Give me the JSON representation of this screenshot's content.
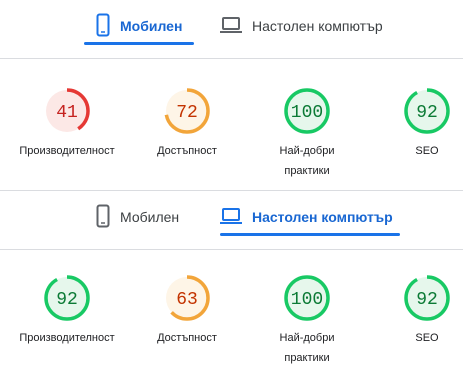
{
  "colors": {
    "accent": "#1a73e8",
    "fail": "#e53935",
    "fail_bg": "#fce8e6",
    "average": "#f2a53a",
    "average_bg": "#fef5e7",
    "average_text": "#c33300",
    "pass": "#18c964",
    "pass_bg": "#e6f7ec",
    "pass_text": "#0b7a35",
    "fail_text": "#c5221f"
  },
  "reports": [
    {
      "tabs": {
        "mobile_label": "Мобилен",
        "desktop_label": "Настолен компютър",
        "active": "mobile"
      },
      "scores": [
        {
          "value": "41",
          "label": "Производителност",
          "level": "fail",
          "score": 0.41
        },
        {
          "value": "72",
          "label": "Достъпност",
          "level": "average",
          "score": 0.72
        },
        {
          "value": "100",
          "label": "Най-добри практики",
          "level": "pass",
          "score": 1.0
        },
        {
          "value": "92",
          "label": "SEO",
          "level": "pass",
          "score": 0.92
        }
      ]
    },
    {
      "tabs": {
        "mobile_label": "Мобилен",
        "desktop_label": "Настолен компютър",
        "active": "desktop"
      },
      "scores": [
        {
          "value": "92",
          "label": "Производителност",
          "level": "pass",
          "score": 0.92
        },
        {
          "value": "63",
          "label": "Достъпност",
          "level": "average",
          "score": 0.63
        },
        {
          "value": "100",
          "label": "Най-добри практики",
          "level": "pass",
          "score": 1.0
        },
        {
          "value": "92",
          "label": "SEO",
          "level": "pass",
          "score": 0.92
        }
      ]
    }
  ]
}
